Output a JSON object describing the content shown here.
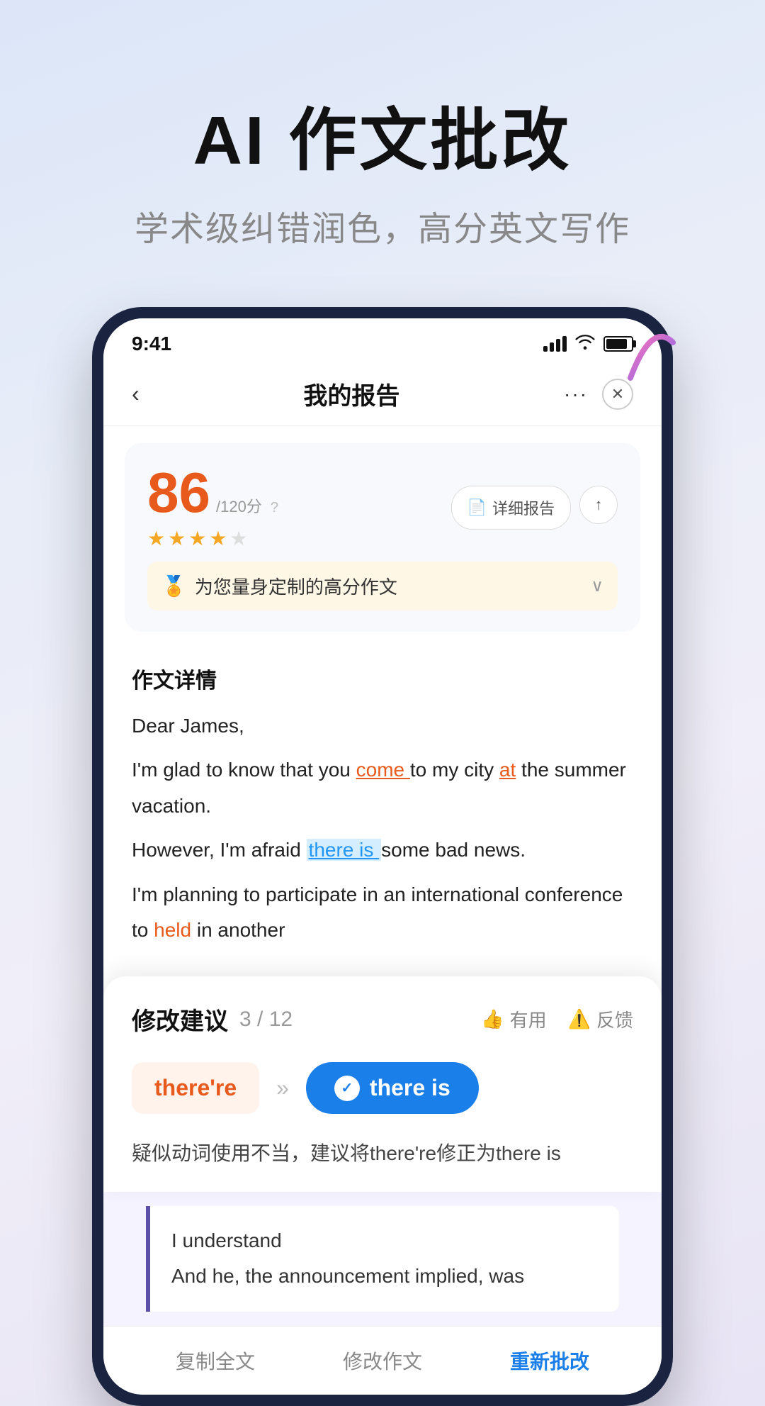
{
  "header": {
    "title": "AI 作文批改",
    "subtitle": "学术级纠错润色，高分英文写作"
  },
  "phone": {
    "status_bar": {
      "time": "9:41",
      "signal": "●●●●",
      "wifi": "WiFi",
      "battery": "Battery"
    },
    "nav": {
      "back": "‹",
      "title": "我的报告",
      "more": "···",
      "close": "✕"
    },
    "score_card": {
      "score": "86",
      "max": "/120分",
      "help": "?",
      "stars": [
        1,
        1,
        1,
        1,
        0
      ],
      "btn_report": "详细报告",
      "btn_share": "↑",
      "highlight_icon": "🏅",
      "highlight_text": "为您量身定制的高分作文",
      "chevron": "∨"
    },
    "essay": {
      "label": "作文详情",
      "lines": [
        "Dear James,",
        "I'm glad to know that you come  to my city at  the summer vacation.",
        "However, I'm afraid there is  some bad news.",
        "I'm planning to participate in an international conference to held  in another"
      ]
    },
    "suggestion": {
      "title": "修改建议",
      "current": "3",
      "total": "12",
      "useful_label": "有用",
      "feedback_label": "反馈",
      "wrong_word": "there're",
      "arrow": "»",
      "correct_word": "there is",
      "explanation": "疑似动词使用不当，建议将there're修正为there is"
    },
    "excerpt": {
      "line1": "I understand",
      "line2": "And he, the announcement implied, was"
    },
    "toolbar": {
      "copy": "复制全文",
      "revise": "修改作文",
      "recheck": "重新批改"
    }
  }
}
